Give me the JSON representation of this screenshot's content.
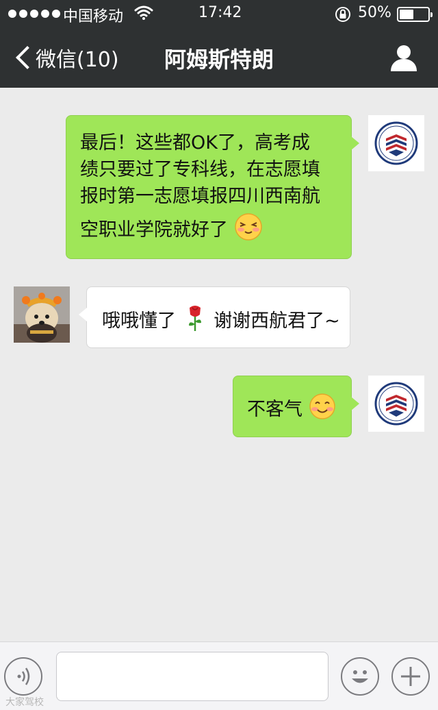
{
  "status_bar": {
    "carrier": "中国移动",
    "time": "17:42",
    "battery_percent": "50%",
    "battery_level": 0.5,
    "icons": [
      "signal-dots",
      "wifi-icon",
      "orientation-lock-icon",
      "battery-icon"
    ]
  },
  "nav": {
    "back_label": "微信(10)",
    "title": "阿姆斯特朗",
    "right_icon": "person-icon"
  },
  "messages": [
    {
      "direction": "outgoing",
      "sender": "school",
      "lines": [
        "最后！这些都OK了，高考成",
        "绩只要过了专科线，在志愿填",
        "报时第一志愿填报四川西南航",
        "空职业学院就好了"
      ],
      "trailing_emoji": "shy-smile-emoji"
    },
    {
      "direction": "incoming",
      "sender": "dog",
      "text_before": "哦哦懂了",
      "inline_emoji": "rose-emoji",
      "text_after": "谢谢西航君了~"
    },
    {
      "direction": "outgoing",
      "sender": "school",
      "text": "不客气",
      "trailing_emoji": "smile-emoji"
    }
  ],
  "toolbar": {
    "left_icon": "voice-icon",
    "input_value": "",
    "emoji_icon": "emoji-face-icon",
    "more_icon": "plus-icon"
  },
  "watermark": "大家驾校",
  "colors": {
    "nav_bg": "#2e3132",
    "chat_bg": "#ebebeb",
    "outgoing_bubble": "#9fe658",
    "incoming_bubble": "#ffffff"
  }
}
